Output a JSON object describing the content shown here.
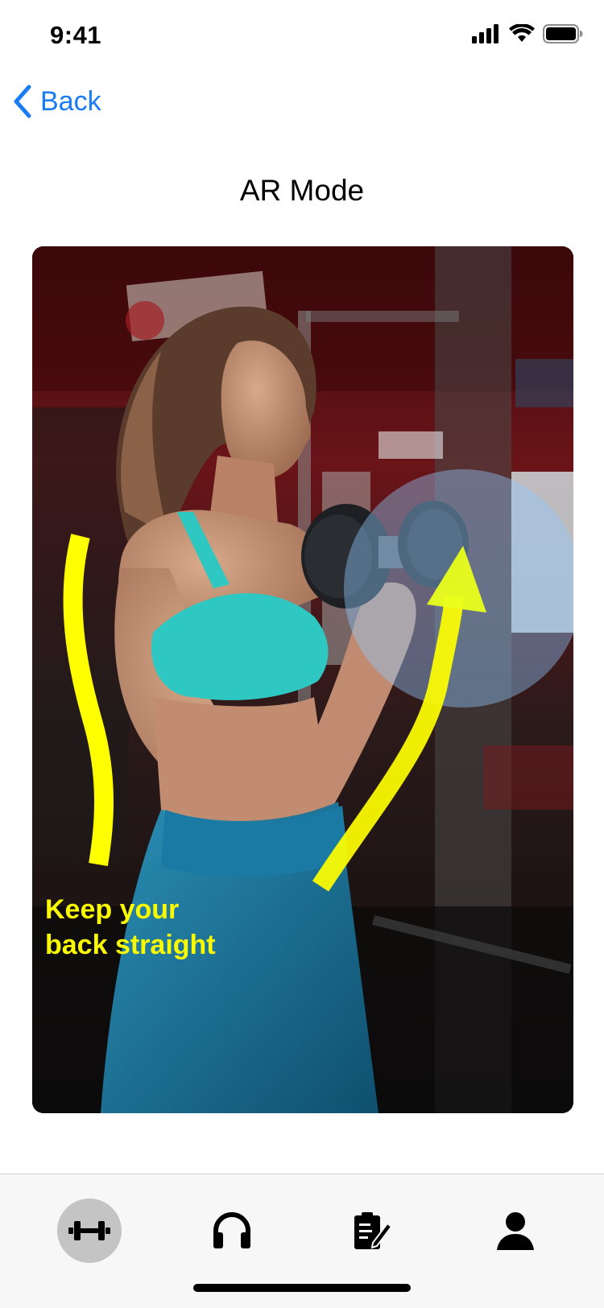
{
  "status_bar": {
    "time": "9:41",
    "icons": [
      "cellular-signal-icon",
      "wifi-icon",
      "battery-icon"
    ]
  },
  "nav": {
    "back_label": "Back",
    "back_icon": "chevron-left-icon",
    "title": "AR Mode"
  },
  "ar_view": {
    "scene": "photo-woman-dumbbell-curl-gym",
    "caption_line1": "Keep your",
    "caption_line2": "back straight",
    "overlays": [
      "posture-guide-line",
      "motion-arrow",
      "target-highlight-circle"
    ],
    "colors": {
      "guide": "#ffff00",
      "highlight": "#8ecbff"
    }
  },
  "tab_bar": {
    "tabs": [
      {
        "icon": "dumbbell-icon",
        "active": true
      },
      {
        "icon": "headphones-icon",
        "active": false
      },
      {
        "icon": "clipboard-edit-icon",
        "active": false
      },
      {
        "icon": "person-icon",
        "active": false
      }
    ]
  },
  "colors": {
    "accent": "#1a7cf5",
    "tab_active_bg": "#c4c4c4"
  }
}
